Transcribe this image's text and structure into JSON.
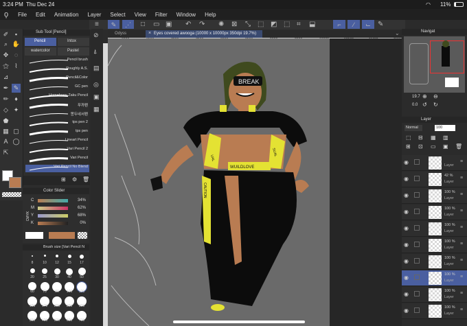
{
  "status": {
    "time": "3:24 PM",
    "date": "Thu Dec 24",
    "battery": "11%"
  },
  "menu": [
    "File",
    "Edit",
    "Animation",
    "Layer",
    "Select",
    "View",
    "Filter",
    "Window",
    "Help"
  ],
  "subtool": {
    "title": "Sub Tool [Pencil]",
    "tabs": [
      "Pencil",
      "Intox",
      "watercolor",
      "Pastel"
    ],
    "brushes": [
      "Pencil brush",
      "Roughly A.S.",
      "Pencil&Color",
      "GC pen",
      "Homebrew Zaku Pencil",
      "푸까펜",
      "몽두네서펜",
      "tps pen 2",
      "tps pen",
      "Lineart Pencil",
      "Vari Pencil 2",
      "Vari Pencil",
      "Vari Pencil No Blend"
    ]
  },
  "colorslider": {
    "title": "Color Slider",
    "mode": "CMYK",
    "channels": [
      {
        "k": "C",
        "v": "34%"
      },
      {
        "k": "M",
        "v": "62%"
      },
      {
        "k": "Y",
        "v": "68%"
      },
      {
        "k": "K",
        "v": "0%"
      }
    ]
  },
  "brushsize": {
    "title": "Brush size [Vari Pencil N",
    "sizes": [
      "8",
      "10",
      "12",
      "15",
      "17",
      "20",
      "25",
      "30",
      "40",
      "50",
      "60",
      "70",
      "80",
      "100",
      "120",
      "150",
      "170",
      "200",
      "250",
      "300",
      "350",
      "400",
      "500",
      "600",
      "700"
    ]
  },
  "document": {
    "tab1": "Odyss",
    "tab2": "Eyes covered awooga (10000 x 10000px 350dpi 19.7%)"
  },
  "ruler": [
    "6000",
    "6500",
    "7000",
    "7500",
    "8000",
    "8500",
    "9000",
    "9500",
    "10000",
    "10500",
    "11000",
    "11500"
  ],
  "artwork": {
    "visor_text": "BREAK",
    "bands": [
      "WUILDLOVE",
      "UAL",
      "SUAL",
      "CAUTION"
    ]
  },
  "navigator": {
    "title": "Navigat",
    "zoom": "19.7",
    "angle": "0.0"
  },
  "layer": {
    "title": "Layer",
    "blend": "Normal",
    "opacity": "100"
  },
  "layers": [
    {
      "op": "",
      "name": "Layer"
    },
    {
      "op": "42 %",
      "name": "Layer"
    },
    {
      "op": "100 %",
      "name": "Layer"
    },
    {
      "op": "100 %",
      "name": "Layer"
    },
    {
      "op": "100 %",
      "name": "Layer"
    },
    {
      "op": "100 %",
      "name": "Layer"
    },
    {
      "op": "100 %",
      "name": "Layer"
    },
    {
      "op": "100 %",
      "name": "Layer"
    },
    {
      "op": "100 %",
      "name": "Layer"
    },
    {
      "op": "100 %",
      "name": "Layer"
    }
  ],
  "colors": {
    "accent": "#4a5fa0",
    "skin": "#b97c52",
    "yellow": "#e4e233",
    "cloth": "#0c0c0c",
    "hair": "#3f4a1e",
    "canvas_bg": "#595959"
  }
}
